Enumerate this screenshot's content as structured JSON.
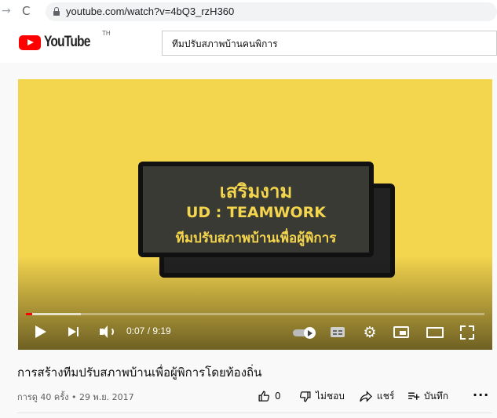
{
  "browser": {
    "url": "youtube.com/watch?v=4bQ3_rzH360",
    "forward_glyph": "→",
    "reload_glyph": "C"
  },
  "header": {
    "logo_text": "YouTube",
    "region": "TH",
    "search_value": "ทีมปรับสภาพบ้านคนพิการ"
  },
  "player": {
    "background_color": "#f4d54e",
    "thumbnail": {
      "line1": "เสริมงาม",
      "line2": "UD : TEAMWORK",
      "line3": "ทีมปรับสภาพบ้านเพื่อผู้พิการ"
    },
    "time_display": "0:07 / 9:19",
    "progress_played_fraction": 0.013,
    "progress_buffered_fraction": 0.12
  },
  "video": {
    "title": "การสร้างทีมปรับสภาพบ้านเพื่อผู้พิการโดยท้องถิ่น",
    "meta": "การดู 40 ครั้ง • 29 พ.ย. 2017",
    "actions": {
      "like_count": "0",
      "dislike_label": "ไม่ชอบ",
      "share_label": "แชร์",
      "save_label": "บันทึก",
      "more_label": "···"
    }
  },
  "icons": {
    "like": "thumb-up-icon",
    "dislike": "thumb-down-icon",
    "share": "share-arrow-icon",
    "save": "playlist-add-icon",
    "settings": "gear-icon"
  }
}
